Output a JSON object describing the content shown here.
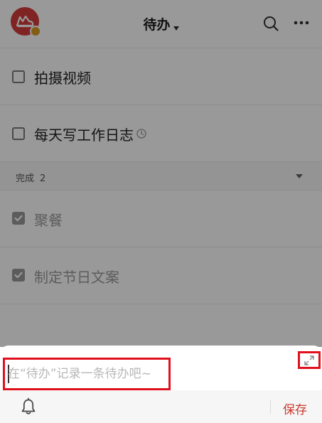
{
  "header": {
    "title": "待办",
    "avatar_icon": "cloud-avatar-icon",
    "search_icon": "search-icon",
    "more_icon": "more-icon"
  },
  "todos": [
    {
      "label": "拍摄视频",
      "checked": false
    },
    {
      "label": "每天写工作日志",
      "checked": false,
      "reminder_icon": "clock-icon"
    }
  ],
  "completed_section": {
    "label": "完成",
    "count": "2"
  },
  "completed": [
    {
      "label": "聚餐",
      "checked": true
    },
    {
      "label": "制定节日文案",
      "checked": true
    }
  ],
  "composer": {
    "placeholder": "在“待办”记录一条待办吧~",
    "value": "",
    "expand_icon": "expand-icon",
    "reminder_icon": "bell-icon",
    "save_label": "保存"
  },
  "colors": {
    "accent_red": "#c83a2e",
    "highlight_red": "#e0111d",
    "avatar_red": "#d63b3b",
    "overlay": "rgba(0,0,0,0.40)"
  }
}
